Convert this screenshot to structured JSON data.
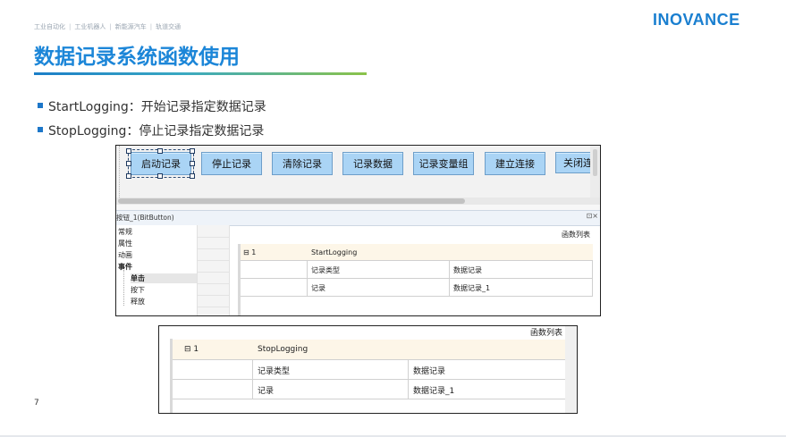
{
  "header": {
    "nav": [
      "工业自动化",
      "工业机器人",
      "新能源汽车",
      "轨道交通"
    ],
    "nav_sep": "|",
    "brand": "INOVANCE",
    "title": "数据记录系统函数使用"
  },
  "bullets": [
    {
      "name": "StartLogging",
      "text": "：开始记录指定数据记录"
    },
    {
      "name": "StopLogging",
      "text": "：停止记录指定数据记录"
    }
  ],
  "shot1": {
    "buttons": [
      "启动记录",
      "停止记录",
      "清除记录",
      "记录数据",
      "记录变量组",
      "建立连接",
      "关闭连"
    ],
    "panel_title": "按钮_1(BitButton)",
    "panel_icons": "⊡×",
    "tree": [
      "常规",
      "属性",
      "动画",
      "事件",
      "单击",
      "按下",
      "释放"
    ],
    "fn_list_label": "函数列表",
    "table": {
      "index": "⊟ 1",
      "function": "StartLogging",
      "rows": [
        {
          "param": "记录类型",
          "value": "数据记录"
        },
        {
          "param": "记录",
          "value": "数据记录_1"
        }
      ]
    }
  },
  "shot2": {
    "fn_list_label": "函数列表",
    "table": {
      "index": "⊟ 1",
      "function": "StopLogging",
      "rows": [
        {
          "param": "记录类型",
          "value": "数据记录"
        },
        {
          "param": "记录",
          "value": "数据记录_1"
        }
      ]
    }
  },
  "page_number": "7",
  "colors": {
    "accent": "#1c86d8",
    "button": "#aad4f5",
    "bullet": "#1d77c9"
  }
}
